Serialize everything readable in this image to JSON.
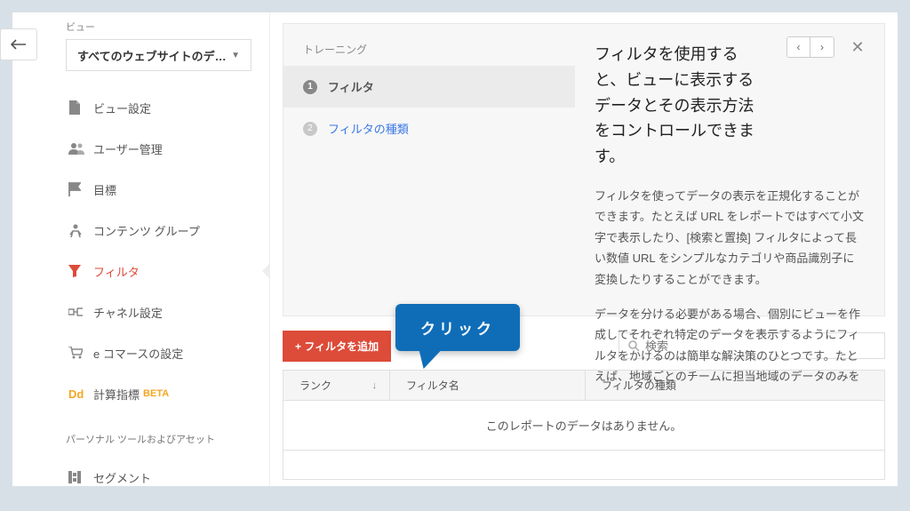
{
  "sidebar": {
    "section_label": "ビュー",
    "view_selector": "すべてのウェブサイトのデ…",
    "items": [
      {
        "label": "ビュー設定"
      },
      {
        "label": "ユーザー管理"
      },
      {
        "label": "目標"
      },
      {
        "label": "コンテンツ グループ"
      },
      {
        "label": "フィルタ"
      },
      {
        "label": "チャネル設定"
      },
      {
        "label": "e コマースの設定"
      },
      {
        "label": "計算指標",
        "badge": "BETA"
      }
    ],
    "personal_section": "パーソナル ツールおよびアセット",
    "personal_items": [
      {
        "label": "セグメント"
      }
    ]
  },
  "help": {
    "nav_header": "トレーニング",
    "steps": [
      {
        "num": "1",
        "label": "フィルタ"
      },
      {
        "num": "2",
        "label": "フィルタの種類"
      }
    ],
    "title": "フィルタを使用すると、ビューに表示するデータとその表示方法をコントロールできます。",
    "p1": "フィルタを使ってデータの表示を正規化することができます。たとえば URL をレポートではすべて小文字で表示したり、[検索と置換] フィルタによって長い数値 URL をシンプルなカテゴリや商品識別子に変換したりすることができます。",
    "p2": "データを分ける必要がある場合、個別にビューを作成してそれぞれ特定のデータを表示するようにフィルタをかけるのは簡単な解決策のひとつです。たとえば、地域ごとのチームに担当地域のデータのみを"
  },
  "actions": {
    "add_filter": "+ フィルタを追加",
    "search_placeholder": "検索"
  },
  "table": {
    "col_rank": "ランク",
    "col_name": "フィルタ名",
    "col_type": "フィルタの種類",
    "empty": "このレポートのデータはありません。"
  },
  "callout": {
    "text": "クリック"
  }
}
